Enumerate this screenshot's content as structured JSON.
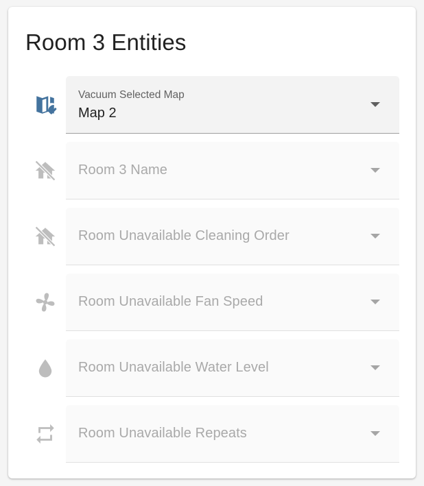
{
  "card": {
    "title": "Room 3 Entities"
  },
  "colors": {
    "active_icon": "#44739e",
    "disabled_icon": "#bdbdbd",
    "disabled_text": "#a9a9a9"
  },
  "entities": [
    {
      "icon": "map-check-icon",
      "label": "Vacuum Selected Map",
      "value": "Map 2",
      "state": "active"
    },
    {
      "icon": "home-off-icon",
      "label": "Room 3 Name",
      "value": "",
      "state": "unavailable"
    },
    {
      "icon": "home-off-icon",
      "label": "Room Unavailable Cleaning Order",
      "value": "",
      "state": "unavailable"
    },
    {
      "icon": "fan-icon",
      "label": "Room Unavailable Fan Speed",
      "value": "",
      "state": "unavailable"
    },
    {
      "icon": "water-drop-icon",
      "label": "Room Unavailable Water Level",
      "value": "",
      "state": "unavailable"
    },
    {
      "icon": "repeat-icon",
      "label": "Room Unavailable Repeats",
      "value": "",
      "state": "unavailable"
    }
  ]
}
